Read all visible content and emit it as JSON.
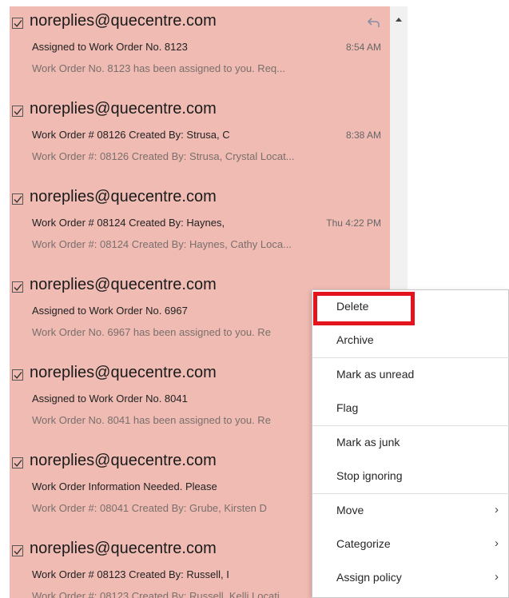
{
  "emails": [
    {
      "sender": "noreplies@quecentre.com",
      "subject": "Assigned to Work Order No. 8123",
      "time": "8:54 AM",
      "preview": "Work Order No. 8123 has been assigned to you.  Req..."
    },
    {
      "sender": "noreplies@quecentre.com",
      "subject": "Work Order # 08126 Created By: Strusa, C",
      "time": "8:38 AM",
      "preview": "Work Order #: 08126 Created By: Strusa, Crystal Locat..."
    },
    {
      "sender": "noreplies@quecentre.com",
      "subject": "Work Order # 08124 Created By: Haynes,",
      "time": "Thu 4:22 PM",
      "preview": "Work Order #: 08124 Created By: Haynes, Cathy Loca..."
    },
    {
      "sender": "noreplies@quecentre.com",
      "subject": "Assigned to Work Order No. 6967",
      "time": "",
      "preview": "Work Order No. 6967 has been assigned to you.  Re"
    },
    {
      "sender": "noreplies@quecentre.com",
      "subject": "Assigned to Work Order No. 8041",
      "time": "",
      "preview": "Work Order No. 8041 has been assigned to you.  Re"
    },
    {
      "sender": "noreplies@quecentre.com",
      "subject": "Work Order Information Needed. Please",
      "time": "",
      "preview": "Work Order #: 08041 Created By: Grube, Kirsten  D"
    },
    {
      "sender": "noreplies@quecentre.com",
      "subject": "Work Order # 08123 Created By: Russell, I",
      "time": "",
      "preview": "Work Order #: 08123 Created By: Russell, Kelli Locati..."
    }
  ],
  "context_menu": {
    "items": [
      {
        "label": "Delete",
        "arrow": ""
      },
      {
        "label": "Archive",
        "arrow": ""
      },
      {
        "label": "Mark as unread",
        "arrow": ""
      },
      {
        "label": "Flag",
        "arrow": ""
      },
      {
        "label": "Mark as junk",
        "arrow": ""
      },
      {
        "label": "Stop ignoring",
        "arrow": ""
      },
      {
        "label": "Move",
        "arrow": "›"
      },
      {
        "label": "Categorize",
        "arrow": "›"
      },
      {
        "label": "Assign policy",
        "arrow": "›"
      }
    ]
  },
  "colors": {
    "selected_row_bg": "#efbbb3",
    "highlight_border": "#e3141b"
  },
  "icons": {
    "checkbox": "checked-checkbox-icon",
    "reply": "reply-arrow-icon",
    "submenu": "chevron-right-icon",
    "scroll": "scroll-up-arrow-icon"
  }
}
